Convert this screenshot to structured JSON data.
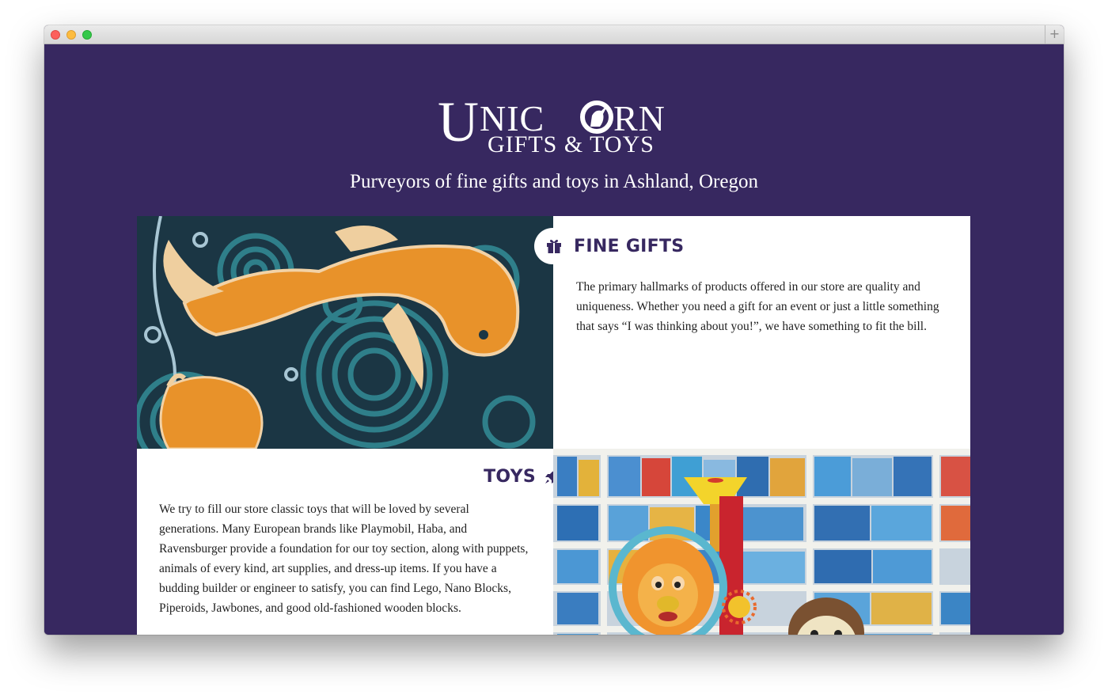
{
  "brand": {
    "logo_main": "UNICORN",
    "logo_sub": "GIFTS & TOYS"
  },
  "tagline": "Purveyors of fine gifts and toys in Ashland, Oregon",
  "sections": {
    "gifts": {
      "icon": "gift-icon",
      "title": "FINE GIFTS",
      "body": "The primary hallmarks of products offered in our store are quality and uniqueness. Whether you need a gift for an event or just a little something that says “I was thinking about you!”, we have something to fit the bill."
    },
    "toys": {
      "icon": "rocket-icon",
      "title": "TOYS",
      "body": "We try to fill our store classic toys that will be loved by several generations. Many European brands like Playmobil, Haba, and Ravensburger provide a foundation for our toy section, along with puppets, animals of every kind, art supplies, and dress-up items. If you have a budding builder or engineer to satisfy, you can find Lego, Nano Blocks, Piperoids, Jawbones, and good old-fashioned wooden blocks."
    }
  },
  "colors": {
    "brand_purple": "#372860",
    "tile_orange": "#e8922a",
    "tile_teal": "#1f6b78"
  }
}
